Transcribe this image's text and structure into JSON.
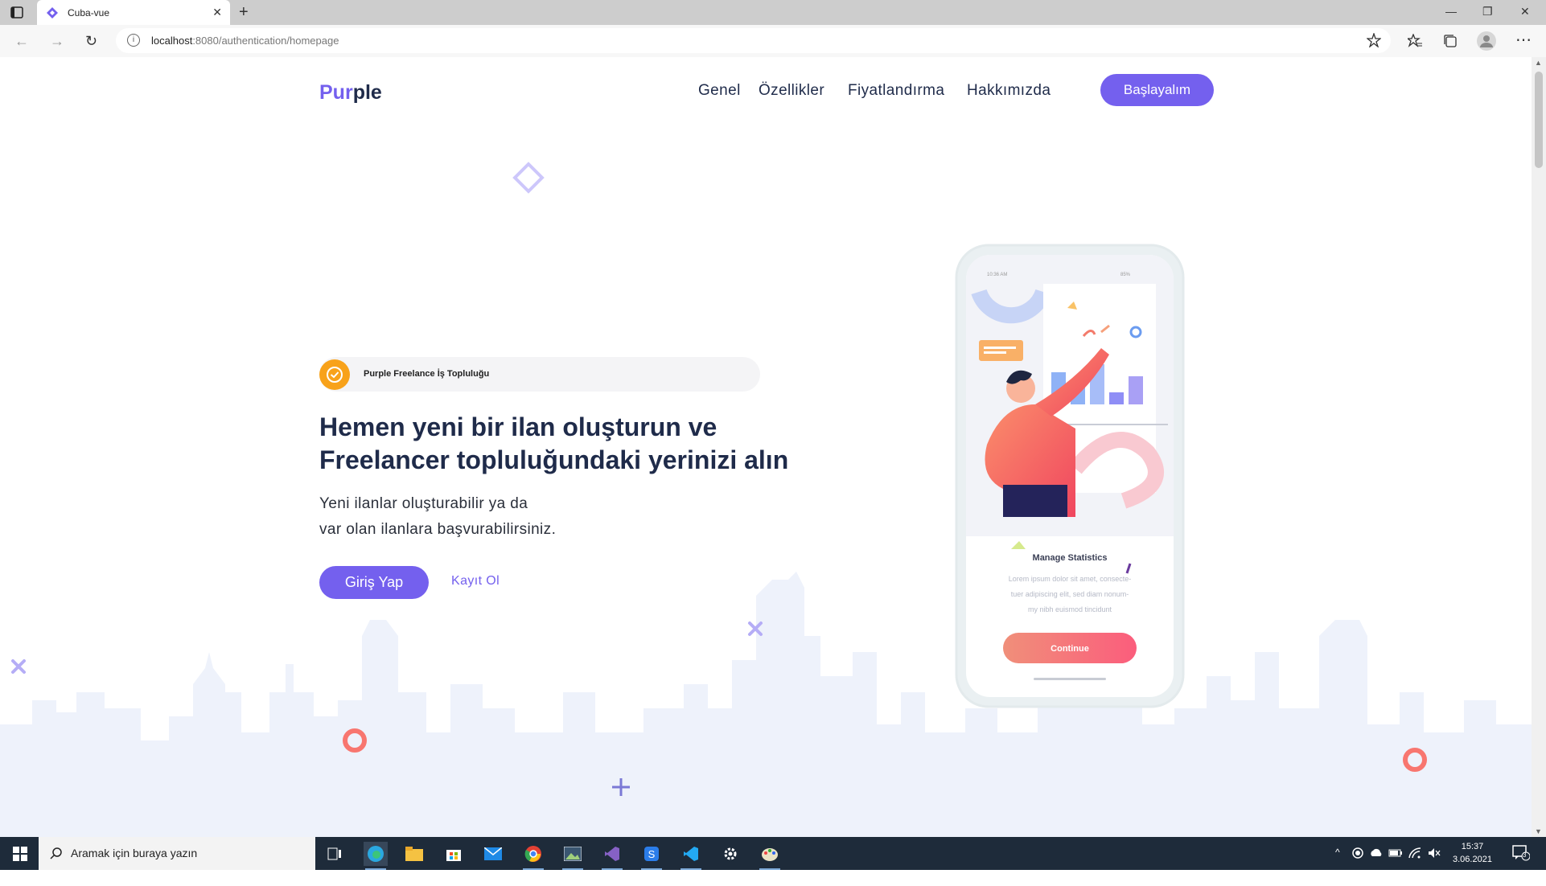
{
  "browser": {
    "tab_title": "Cuba-vue",
    "url_host": "localhost",
    "url_path": ":8080/authentication/homepage"
  },
  "site": {
    "logo_part1": "Pur",
    "logo_part2": "ple",
    "nav": [
      "Genel",
      "Özellikler",
      "Fiyatlandırma",
      "Hakkımızda"
    ],
    "cta": "Başlayalım"
  },
  "hero": {
    "badge": "Purple Freelance İş Topluluğu",
    "headline_line1": "Hemen yeni bir ilan oluşturun ve",
    "headline_line2": "Freelancer topluluğundaki yerinizi alın",
    "sub_line1": "Yeni ilanlar oluşturabilir ya da",
    "sub_line2": "var olan ilanlara başvurabilirsiniz.",
    "login": "Giriş Yap",
    "register": "Kayıt Ol"
  },
  "phone": {
    "status_time": "10:36 AM",
    "status_batt": "85%",
    "card_title": "Manage Statistics",
    "card_text1": "Lorem ipsum dolor sit amet, consecte-",
    "card_text2": "tuer adipiscing elit, sed diam nonum-",
    "card_text3": "my nibh euismod tincidunt",
    "card_button": "Continue"
  },
  "taskbar": {
    "search_placeholder": "Aramak için buraya yazın",
    "time": "15:37",
    "date": "3.06.2021",
    "notifications": "3"
  },
  "colors": {
    "accent": "#7460ee",
    "navy": "#1f2b4a",
    "badge_icon": "#f8a21a",
    "coral": "#f86a6f"
  }
}
